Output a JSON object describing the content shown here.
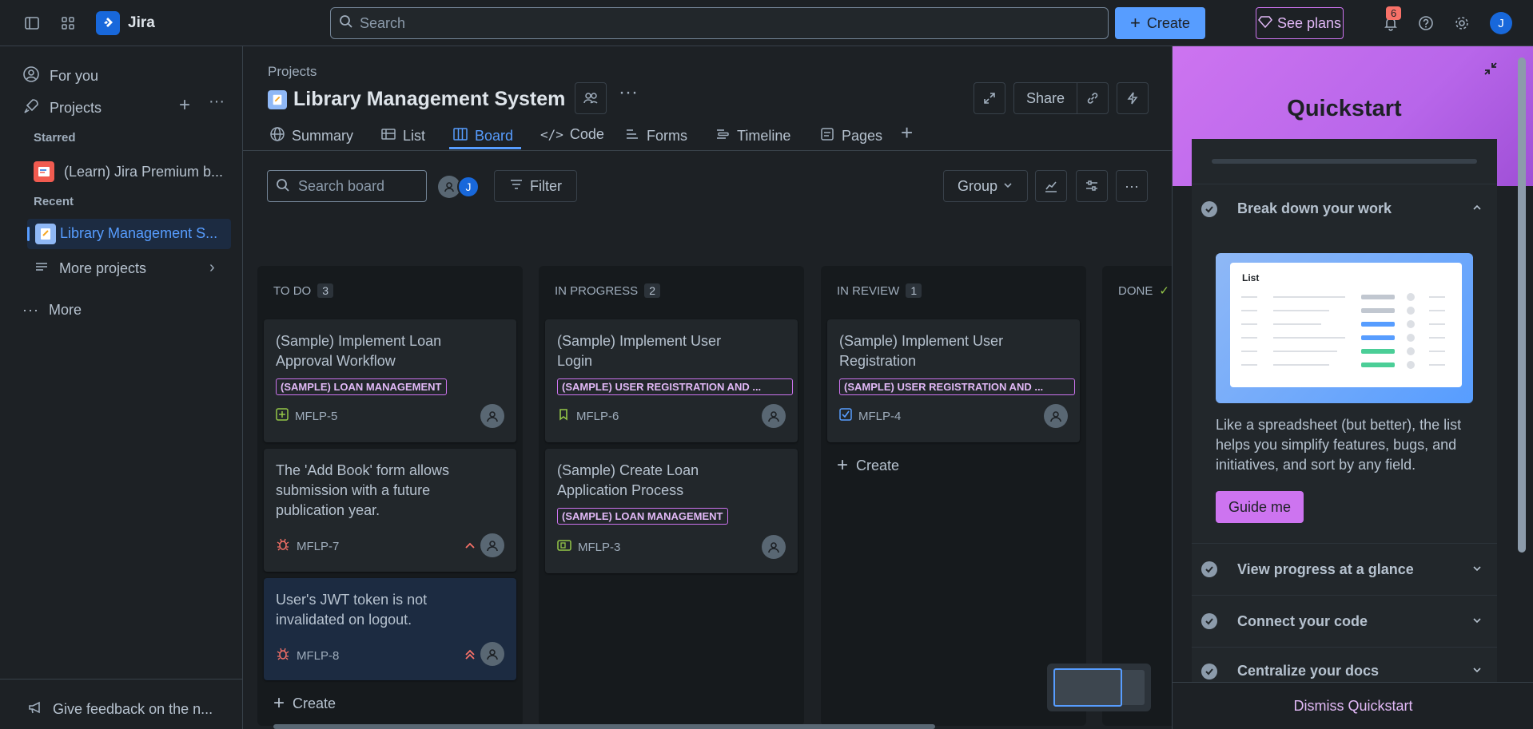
{
  "topbar": {
    "app_name": "Jira",
    "search_placeholder": "Search",
    "create_label": "Create",
    "see_plans_label": "See plans",
    "notification_count": "6",
    "user_initial": "J"
  },
  "sidebar": {
    "for_you": "For you",
    "projects": "Projects",
    "starred_heading": "Starred",
    "starred_item": "(Learn) Jira Premium b...",
    "recent_heading": "Recent",
    "recent_item": "Library Management S...",
    "more_projects": "More projects",
    "more": "More",
    "feedback": "Give feedback on the n..."
  },
  "header": {
    "breadcrumb": "Projects",
    "project_title": "Library Management System",
    "share_label": "Share"
  },
  "tabs": [
    {
      "label": "Summary",
      "icon": "globe-icon"
    },
    {
      "label": "List",
      "icon": "list-icon"
    },
    {
      "label": "Board",
      "icon": "board-icon",
      "active": true
    },
    {
      "label": "Code",
      "icon": "code-icon"
    },
    {
      "label": "Forms",
      "icon": "forms-icon"
    },
    {
      "label": "Timeline",
      "icon": "timeline-icon"
    },
    {
      "label": "Pages",
      "icon": "pages-icon"
    }
  ],
  "toolbar": {
    "search_placeholder": "Search board",
    "filter_label": "Filter",
    "group_label": "Group",
    "avatar_initial": "J"
  },
  "columns": [
    {
      "title": "TO DO",
      "count": "3",
      "cards": [
        {
          "title": "(Sample) Implement Loan Approval Workflow",
          "label": "(SAMPLE) LOAN MANAGEMENT",
          "key": "MFLP-5",
          "type": "story"
        },
        {
          "title": "The 'Add Book' form allows submission with a future publication year.",
          "key": "MFLP-7",
          "type": "bug",
          "priority": "medium"
        },
        {
          "title": "User's JWT token is not invalidated on logout.",
          "key": "MFLP-8",
          "type": "bug",
          "priority": "high"
        }
      ],
      "create_label": "Create"
    },
    {
      "title": "IN PROGRESS",
      "count": "2",
      "cards": [
        {
          "title": "(Sample) Implement User Login",
          "label": "(SAMPLE) USER REGISTRATION AND ...",
          "key": "MFLP-6",
          "type": "story"
        },
        {
          "title": "(Sample) Create Loan Application Process",
          "label": "(SAMPLE) LOAN MANAGEMENT",
          "key": "MFLP-3",
          "type": "subtask"
        }
      ]
    },
    {
      "title": "IN REVIEW",
      "count": "1",
      "cards": [
        {
          "title": "(Sample) Implement User Registration",
          "label": "(SAMPLE) USER REGISTRATION AND ...",
          "key": "MFLP-4",
          "type": "task"
        }
      ],
      "create_label": "Create"
    },
    {
      "title": "DONE"
    }
  ],
  "quickstart": {
    "title": "Quickstart",
    "step1_title": "Break down your work",
    "illustration_label": "List",
    "step1_desc": "Like a spreadsheet (but better), the list helps you simplify features, bugs, and initiatives, and sort by any field.",
    "guide_label": "Guide me",
    "step2_title": "View progress at a glance",
    "step3_title": "Connect your code",
    "step4_title": "Centralize your docs",
    "dismiss_label": "Dismiss Quickstart"
  },
  "colors": {
    "accent": "#579dff",
    "purple": "#cd74f0",
    "bg": "#1d2125",
    "column_bg": "#161a1d",
    "card_bg": "#22272b",
    "bug_red": "#f87168",
    "story_green": "#94c748"
  }
}
